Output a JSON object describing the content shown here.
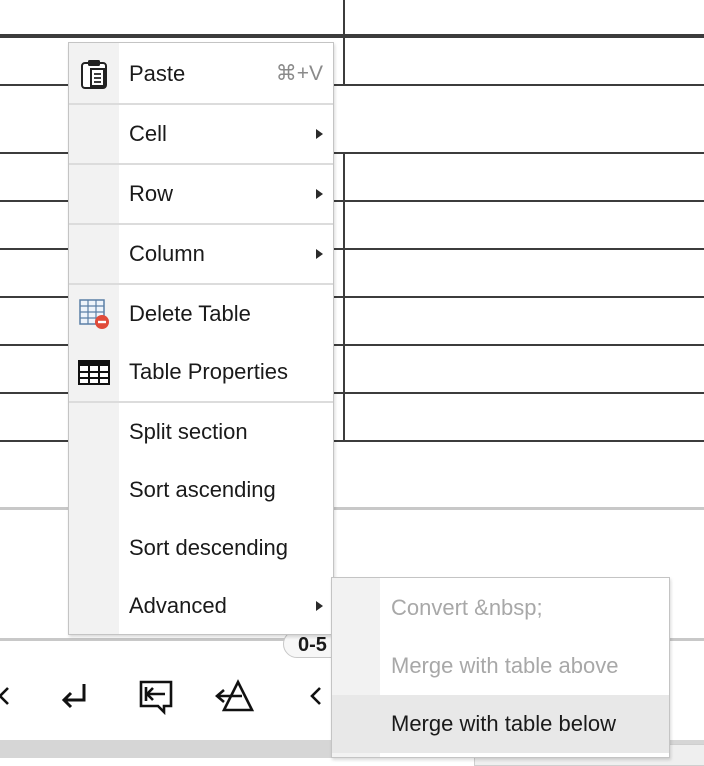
{
  "colors": {
    "table_border": "#3c3c3c",
    "menu_gutter": "#f2f2f2",
    "disabled_text": "#a8a8a8",
    "hover_bg": "#e8e8e8",
    "delete_red": "#e04b3a"
  },
  "context_menu": {
    "items": [
      {
        "label": "Paste",
        "shortcut": "⌘+V",
        "icon": "clipboard-icon"
      },
      {
        "label": "Cell",
        "submenu": true
      },
      {
        "label": "Row",
        "submenu": true
      },
      {
        "label": "Column",
        "submenu": true
      },
      {
        "label": "Delete Table",
        "icon": "delete-table-icon"
      },
      {
        "label": "Table Properties",
        "icon": "table-grid-icon"
      },
      {
        "label": "Split section"
      },
      {
        "label": "Sort ascending"
      },
      {
        "label": "Sort descending"
      },
      {
        "label": "Advanced",
        "submenu": true
      }
    ]
  },
  "advanced_submenu": {
    "items": [
      {
        "label": "Convert &nbsp;",
        "disabled": true
      },
      {
        "label": "Merge with table above",
        "disabled": true
      },
      {
        "label": "Merge with table below",
        "disabled": false,
        "highlighted": true
      }
    ]
  },
  "toolbar": {
    "badge": "0-5",
    "icons": [
      "chevron-left-icon",
      "enter-icon",
      "exit-box-icon",
      "clear-format-icon",
      "chevron-left-icon"
    ]
  }
}
